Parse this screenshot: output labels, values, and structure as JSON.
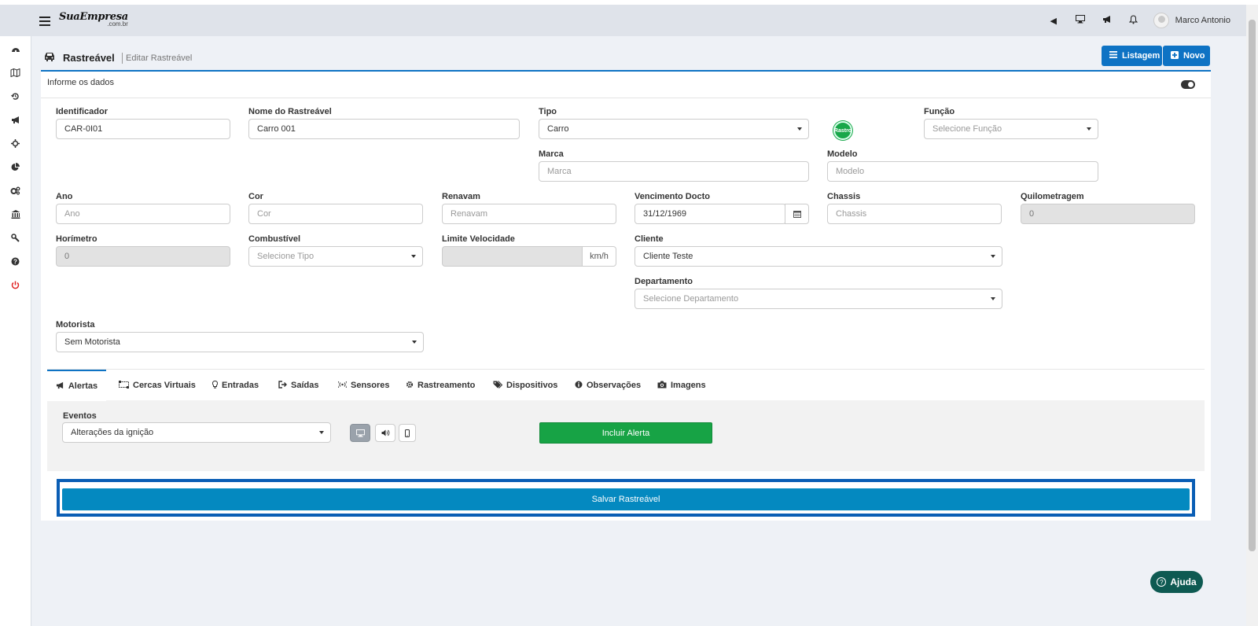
{
  "topbar": {
    "logo_main": "SuaEmpresa",
    "logo_sub": ".com.br",
    "user_name": "Marco Antonio",
    "icons": [
      "caret-left-icon",
      "monitor-icon",
      "megaphone-icon",
      "bell-icon"
    ]
  },
  "sidebar": {
    "items": [
      "dashboard-icon",
      "map-icon",
      "history-icon",
      "megaphone-icon",
      "crosshair-icon",
      "pie-chart-icon",
      "gears-icon",
      "bank-icon",
      "wrench-icon",
      "help-icon",
      "power-icon"
    ],
    "power_color": "#e02424"
  },
  "header": {
    "title": "Rastreável",
    "subtitle": "Editar Rastreável",
    "listagem_label": "Listagem",
    "novo_label": "Novo",
    "accent": "#0e73c4"
  },
  "card": {
    "heading": "Informe os dados"
  },
  "form": {
    "identificador": {
      "label": "Identificador",
      "value": "CAR-0I01"
    },
    "nome": {
      "label": "Nome do Rastreável",
      "value": "Carro 001"
    },
    "tipo": {
      "label": "Tipo",
      "value": "Carro"
    },
    "tipo_badge": "Rastro",
    "funcao": {
      "label": "Função",
      "placeholder": "Selecione Função"
    },
    "marca": {
      "label": "Marca",
      "placeholder": "Marca"
    },
    "modelo": {
      "label": "Modelo",
      "placeholder": "Modelo"
    },
    "ano": {
      "label": "Ano",
      "placeholder": "Ano"
    },
    "cor": {
      "label": "Cor",
      "placeholder": "Cor"
    },
    "renavam": {
      "label": "Renavam",
      "placeholder": "Renavam"
    },
    "vencimento": {
      "label": "Vencimento Docto",
      "value": "31/12/1969"
    },
    "chassis": {
      "label": "Chassis",
      "placeholder": "Chassis"
    },
    "quilometragem": {
      "label": "Quilometragem",
      "value": "0"
    },
    "horimetro": {
      "label": "Horímetro",
      "value": "0"
    },
    "combustivel": {
      "label": "Combustível",
      "placeholder": "Selecione Tipo"
    },
    "limite": {
      "label": "Limite Velocidade",
      "value": "",
      "unit": "km/h"
    },
    "cliente": {
      "label": "Cliente",
      "value": "Cliente Teste"
    },
    "departamento": {
      "label": "Departamento",
      "placeholder": "Selecione Departamento"
    },
    "motorista": {
      "label": "Motorista",
      "value": "Sem Motorista"
    }
  },
  "tabs": [
    {
      "label": "Alertas",
      "icon": "megaphone-icon",
      "active": true
    },
    {
      "label": "Cercas Virtuais",
      "icon": "fence-icon",
      "active": false
    },
    {
      "label": "Entradas",
      "icon": "bulb-icon",
      "active": false
    },
    {
      "label": "Saídas",
      "icon": "sign-out-icon",
      "active": false
    },
    {
      "label": "Sensores",
      "icon": "broadcast-icon",
      "active": false
    },
    {
      "label": "Rastreamento",
      "icon": "cog-icon",
      "active": false
    },
    {
      "label": "Dispositivos",
      "icon": "tags-icon",
      "active": false
    },
    {
      "label": "Observações",
      "icon": "info-icon",
      "active": false
    },
    {
      "label": "Imagens",
      "icon": "camera-icon",
      "active": false
    }
  ],
  "alertas": {
    "eventos_label": "Eventos",
    "eventos_value": "Alterações da ignição",
    "incluir_label": "Incluir Alerta",
    "notify_icons": [
      "monitor-icon",
      "speaker-icon",
      "mobile-icon"
    ]
  },
  "save_label": "Salvar Rastreável",
  "help_label": "Ajuda",
  "colors": {
    "green": "#17a345",
    "save": "#0489c0",
    "help": "#0e5a52"
  }
}
